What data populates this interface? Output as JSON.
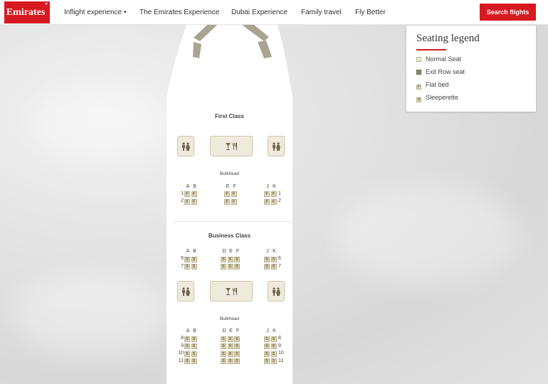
{
  "header": {
    "logo_text": "Emirates",
    "logo_mark": "®",
    "nav": [
      "Inflight experience •",
      "The Emirates Experience",
      "Dubai Experience",
      "Family travel",
      "Fly Better"
    ],
    "search_label": "Search flights",
    "accent": "#d71921"
  },
  "legend": {
    "title": "Seating legend",
    "items": [
      {
        "label": "Normal Seat",
        "code": "",
        "color": "#f1ebd6"
      },
      {
        "label": "Exit Row seat",
        "code": "",
        "color": "#8f8870"
      },
      {
        "label": "Flat bed",
        "code": "F",
        "color": "#e0d8b9"
      },
      {
        "label": "Sleeperette",
        "code": "S",
        "color": "#e0d8b9"
      }
    ]
  },
  "cabins": [
    {
      "name": "First Class",
      "bulkhead": "Bulkhead",
      "col_groups": [
        [
          "A",
          "B"
        ],
        [
          "E",
          "F"
        ],
        [
          "J",
          "K"
        ]
      ],
      "rows": [
        "1",
        "2"
      ],
      "seat_code": "F"
    },
    {
      "name": "Business Class",
      "bulkhead": "Bulkhead",
      "col_groups": [
        [
          "A",
          "B"
        ],
        [
          "D",
          "E",
          "F"
        ],
        [
          "J",
          "K"
        ]
      ],
      "rows_front": [
        "6",
        "7"
      ],
      "rows_back": [
        "8",
        "9",
        "10",
        "11"
      ],
      "seat_code": "S"
    }
  ],
  "facilities": {
    "lavatory_icon": "lavatory-icon",
    "galley_icon": "galley-icon"
  }
}
